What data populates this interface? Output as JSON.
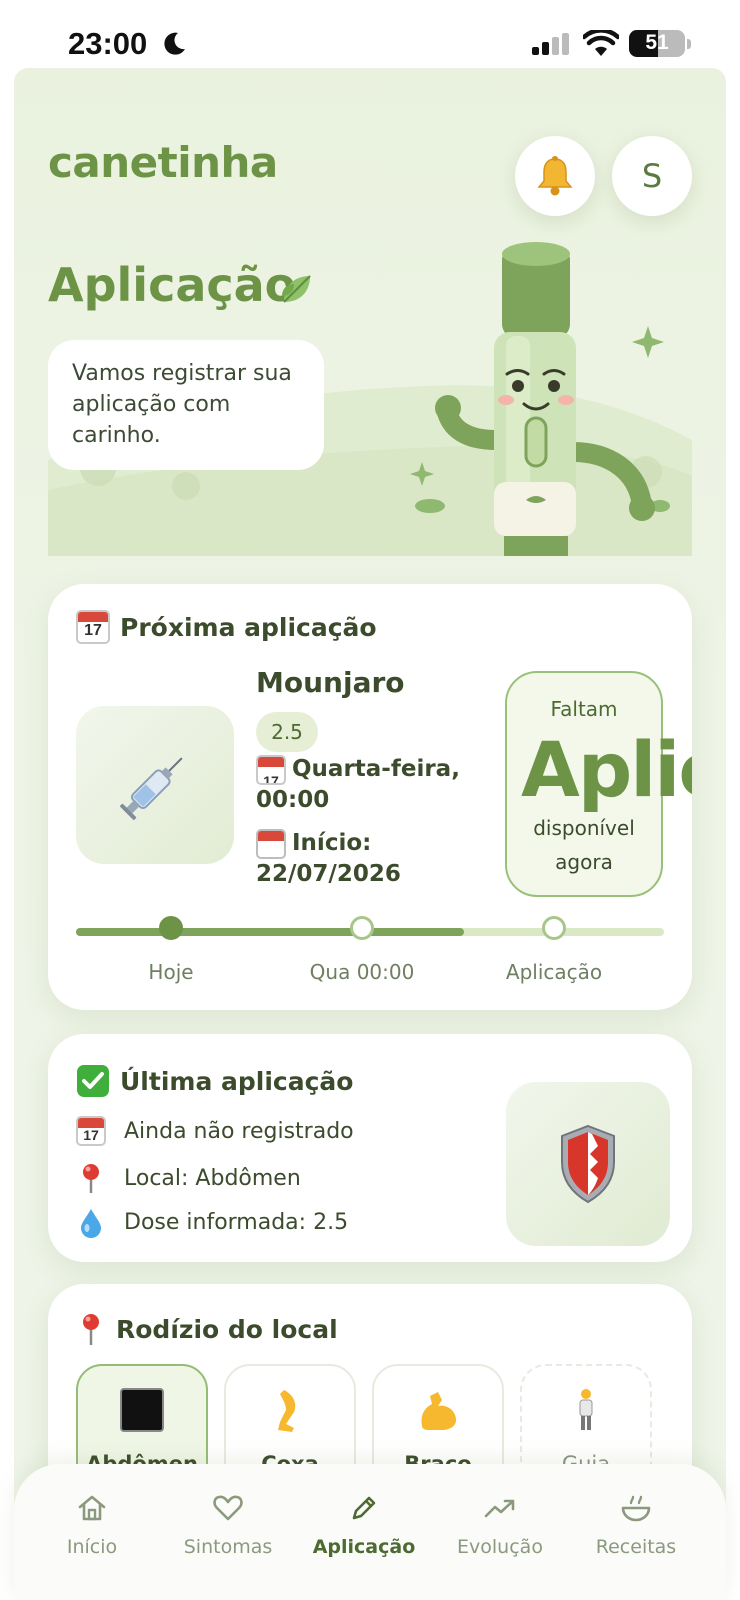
{
  "status_bar": {
    "time": "23:00",
    "battery": "51"
  },
  "header": {
    "brand": "canetinha",
    "profile_initial": "S"
  },
  "hero": {
    "title": "Aplicação",
    "message": "Vamos registrar sua aplicação com carinho."
  },
  "next_application": {
    "title": "Próxima aplicação",
    "medication": "Mounjaro",
    "dose": "2.5",
    "schedule": "Quarta-feira, 00:00",
    "start_label": "Início:",
    "start_date": "22/07/2026",
    "calendar_day": "17",
    "countdown": {
      "label": "Faltam",
      "value": "Aplic",
      "sub_line1": "disponível",
      "sub_line2": "agora"
    },
    "timeline": {
      "progress_fraction": 0.66,
      "labels": [
        "Hoje",
        "Qua 00:00",
        "Aplicação"
      ]
    }
  },
  "last_application": {
    "title": "Última aplicação",
    "status": "Ainda não registrado",
    "site": "Local: Abdômen",
    "dose": "Dose informada: 2.5"
  },
  "rotation": {
    "title": "Rodízio do local",
    "sites": [
      {
        "label": "Abdômen",
        "icon": "black-square-icon",
        "selected": true
      },
      {
        "label": "Coxa",
        "icon": "leg-icon",
        "selected": false
      },
      {
        "label": "Braço",
        "icon": "flexed-biceps-icon",
        "selected": false
      },
      {
        "label": "Guia",
        "icon": "person-standing-icon",
        "selected": false
      }
    ]
  },
  "nav": {
    "items": [
      {
        "label": "Início",
        "icon": "home-icon"
      },
      {
        "label": "Sintomas",
        "icon": "heart-icon"
      },
      {
        "label": "Aplicação",
        "icon": "pencil-icon",
        "active": true
      },
      {
        "label": "Evolução",
        "icon": "trending-up-icon"
      },
      {
        "label": "Receitas",
        "icon": "bowl-icon"
      }
    ]
  },
  "colors": {
    "accent": "#6d9446",
    "background": "#eaf2df",
    "card": "#ffffff"
  }
}
